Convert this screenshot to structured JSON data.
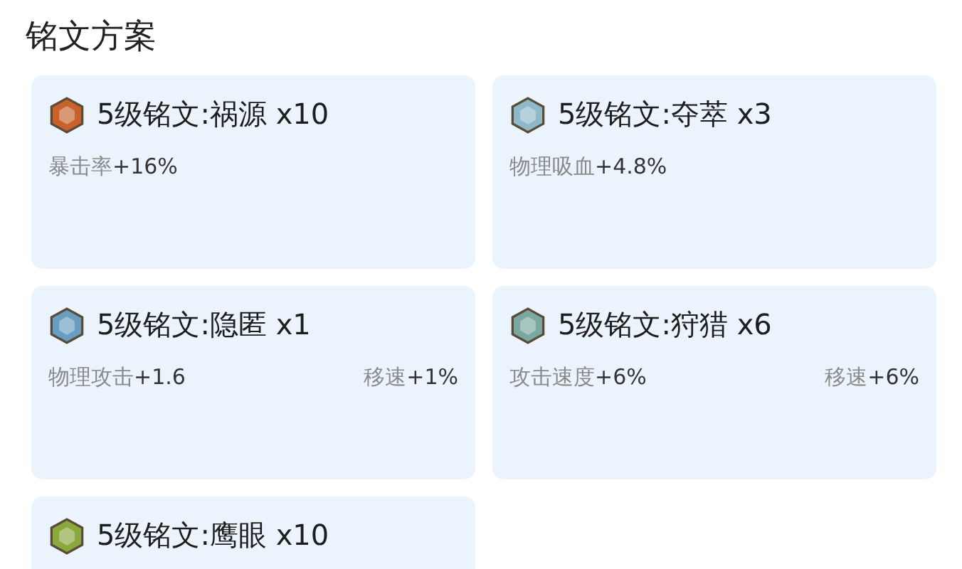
{
  "title": "铭文方案",
  "runes": [
    {
      "name": "5级铭文:祸源 x10",
      "color": "#c8612c",
      "stats": [
        {
          "name": "暴击率",
          "value": "+16%"
        }
      ]
    },
    {
      "name": "5级铭文:夺萃 x3",
      "color": "#8fb8c8",
      "stats": [
        {
          "name": "物理吸血",
          "value": "+4.8%"
        }
      ]
    },
    {
      "name": "5级铭文:隐匿 x1",
      "color": "#6a9ec0",
      "stats": [
        {
          "name": "物理攻击",
          "value": "+1.6"
        },
        {
          "name": "移速",
          "value": "+1%"
        }
      ]
    },
    {
      "name": "5级铭文:狩猎 x6",
      "color": "#7aa8a0",
      "stats": [
        {
          "name": "攻击速度",
          "value": "+6%"
        },
        {
          "name": "移速",
          "value": "+6%"
        }
      ]
    },
    {
      "name": "5级铭文:鹰眼 x10",
      "color": "#8aa83c"
    }
  ]
}
